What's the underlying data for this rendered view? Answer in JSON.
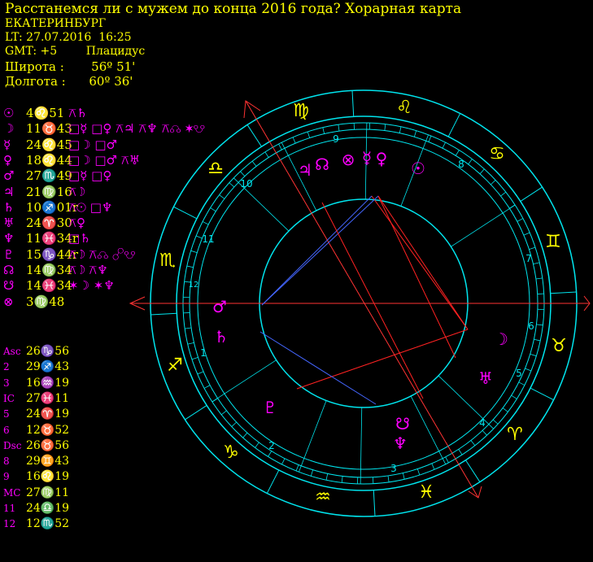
{
  "header": {
    "title": "Расстанемся ли с мужем до конца 2016 года? Хорарная карта",
    "city": "ЕКАТЕРИНБУРГ",
    "lt": "LT: 27.07.2016  16:25",
    "gmt": "GMT: +5        Плацидус",
    "lat": "Широта :       56º 51'",
    "lon": "Долгота :      60º 36'"
  },
  "planets": [
    {
      "glyph": "☉",
      "pos": "4♌51",
      "aspects": "⚻♄"
    },
    {
      "glyph": "☽",
      "pos": "11♉43",
      "aspects": "□☿ □♀ ⚻♃ ⚻♆ ⚻☊ ✶☋"
    },
    {
      "glyph": "☿",
      "pos": "24♌45",
      "aspects": "□☽ □♂"
    },
    {
      "glyph": "♀",
      "pos": "18♌44",
      "aspects": "□☽ □♂ ⚻♅"
    },
    {
      "glyph": "♂",
      "pos": "27♏49",
      "aspects": "□☿ □♀"
    },
    {
      "glyph": "♃",
      "pos": "21♍16",
      "aspects": "⚻☽"
    },
    {
      "glyph": "♄",
      "pos": "10♐01r",
      "aspects": "⚻☉ □♆"
    },
    {
      "glyph": "♅",
      "pos": "24♈30",
      "aspects": "⚻♀"
    },
    {
      "glyph": "♆",
      "pos": "11♓34r",
      "aspects": "□♄"
    },
    {
      "glyph": "♇",
      "pos": "15♑44r",
      "aspects": "⚻☽ ⚻☊ ☍☋"
    },
    {
      "glyph": "☊",
      "pos": "14♍34",
      "aspects": "⚻☽ ⚻♆"
    },
    {
      "glyph": "☋",
      "pos": "14♓34",
      "aspects": "✶☽ ✶♆"
    },
    {
      "glyph": "⊗",
      "pos": "3♍48",
      "aspects": ""
    }
  ],
  "houses": [
    {
      "label": "Asc",
      "pos": "26♑56"
    },
    {
      "label": "2",
      "pos": "29♐43"
    },
    {
      "label": "3",
      "pos": "16♒19"
    },
    {
      "label": "IC",
      "pos": "27♓11"
    },
    {
      "label": "5",
      "pos": "24♈19"
    },
    {
      "label": "6",
      "pos": "12♉52"
    },
    {
      "label": "Dsc",
      "pos": "26♉56"
    },
    {
      "label": "8",
      "pos": "29♊43"
    },
    {
      "label": "9",
      "pos": "16♌19"
    },
    {
      "label": "MC",
      "pos": "27♍11"
    },
    {
      "label": "11",
      "pos": "24♎19"
    },
    {
      "label": "12",
      "pos": "12♏52"
    }
  ],
  "wheel": {
    "signs": [
      "♍",
      "♌",
      "♋",
      "♊",
      "♉",
      "♈",
      "♓",
      "♒",
      "♑",
      "♐",
      "♏",
      "♎"
    ],
    "house_numbers": [
      "1",
      "2",
      "3",
      "4",
      "5",
      "6",
      "7",
      "8",
      "9",
      "10",
      "11",
      "12"
    ],
    "planet_glyphs": {
      "moon": "☽",
      "uranus": "♅",
      "pluto": "♇",
      "south_node": "☋",
      "neptune": "♆",
      "saturn": "♄",
      "mars": "♂",
      "jupiter": "♃",
      "north_node": "☊",
      "fortune": "⊗",
      "mercury": "☿",
      "venus": "♀",
      "sun": "☉"
    }
  },
  "colors": {
    "title": "#ffff00",
    "glyph": "#ff00ff",
    "wheel": "#00e5ee",
    "axis": "#ff3333",
    "aspect_red": "#ff2222",
    "aspect_blue": "#4466ff"
  }
}
